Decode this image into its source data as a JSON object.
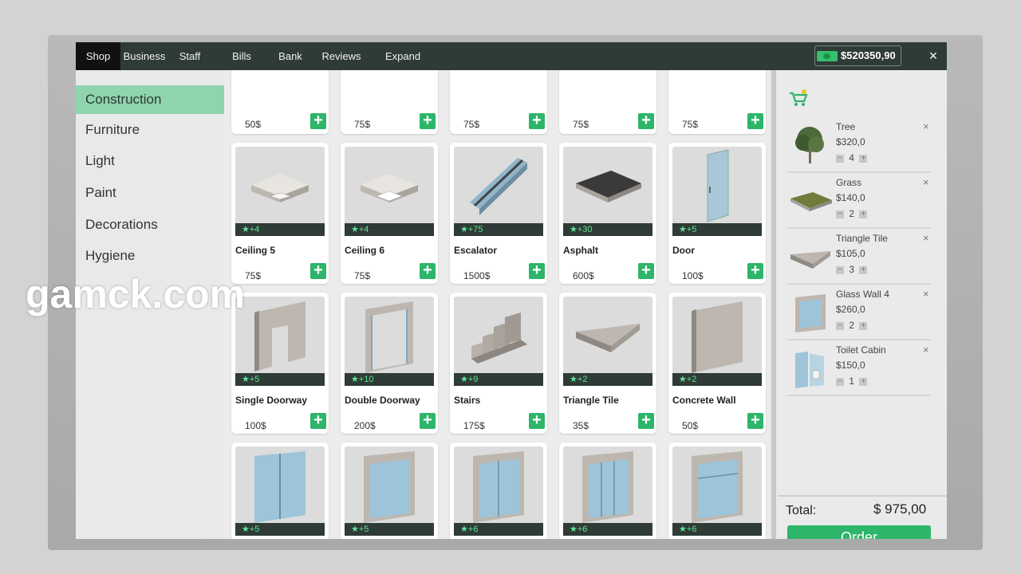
{
  "topbar": {
    "tabs": [
      "Shop",
      "Business",
      "Staff",
      "Bills",
      "Bank",
      "Reviews",
      "Expand"
    ],
    "money": "$520350,90",
    "close": "×"
  },
  "sidebar": {
    "categories": [
      "Construction",
      "Furniture",
      "Light",
      "Paint",
      "Decorations",
      "Hygiene"
    ]
  },
  "grid": {
    "partial_row_prices": [
      "50$",
      "75$",
      "75$",
      "75$",
      "75$"
    ],
    "row2": [
      {
        "name": "Ceiling 5",
        "price": "75$",
        "badge": "★+4"
      },
      {
        "name": "Ceiling 6",
        "price": "75$",
        "badge": "★+4"
      },
      {
        "name": "Escalator",
        "price": "1500$",
        "badge": "★+75"
      },
      {
        "name": "Asphalt",
        "price": "600$",
        "badge": "★+30"
      },
      {
        "name": "Door",
        "price": "100$",
        "badge": "★+5"
      }
    ],
    "row3": [
      {
        "name": "Single Doorway",
        "price": "100$",
        "badge": "★+5"
      },
      {
        "name": "Double Doorway",
        "price": "200$",
        "badge": "★+10"
      },
      {
        "name": "Stairs",
        "price": "175$",
        "badge": "★+9"
      },
      {
        "name": "Triangle Tile",
        "price": "35$",
        "badge": "★+2"
      },
      {
        "name": "Concrete Wall",
        "price": "50$",
        "badge": "★+2"
      }
    ],
    "row4_badges": [
      "★+5",
      "★+5",
      "★+6",
      "★+6",
      "★+6"
    ],
    "add_symbol": "+"
  },
  "cart": {
    "items": [
      {
        "name": "Tree",
        "price": "$320,0",
        "qty": "4"
      },
      {
        "name": "Grass",
        "price": "$140,0",
        "qty": "2"
      },
      {
        "name": "Triangle Tile",
        "price": "$105,0",
        "qty": "3"
      },
      {
        "name": "Glass Wall 4",
        "price": "$260,0",
        "qty": "2"
      },
      {
        "name": "Toilet Cabin",
        "price": "$150,0",
        "qty": "1"
      }
    ],
    "remove": "×",
    "minus": "−",
    "plus": "+",
    "total_label": "Total:",
    "total_value": "$ 975,00",
    "order_label": "Order"
  },
  "watermark": "gamck.com",
  "colors": {
    "accent_green": "#2db56a",
    "topbar": "#2f3b36",
    "active_category": "#8fd4ad",
    "badge_text": "#5fe59a"
  }
}
